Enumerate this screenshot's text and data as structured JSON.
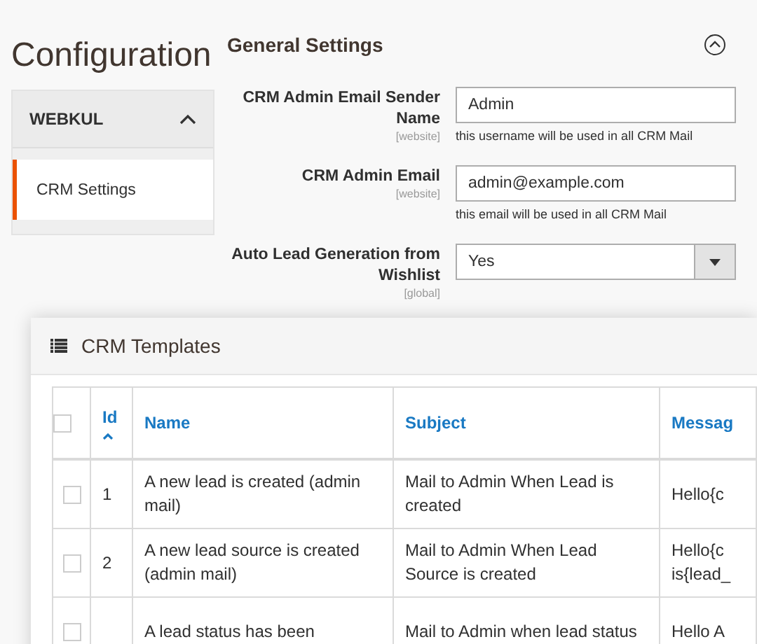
{
  "page_title": "Configuration",
  "sidebar": {
    "group": {
      "label": "WEBKUL",
      "expanded": true
    },
    "items": [
      {
        "label": "CRM Settings",
        "selected": true
      }
    ]
  },
  "section": {
    "title": "General Settings",
    "expanded": true,
    "fields": [
      {
        "kind": "text",
        "label": "CRM Admin Email Sender Name",
        "scope": "[website]",
        "value": "Admin",
        "note": "this username will be used in all CRM Mail"
      },
      {
        "kind": "text",
        "label": "CRM Admin Email",
        "scope": "[website]",
        "value": "admin@example.com",
        "note": "this email will be used in all CRM Mail"
      },
      {
        "kind": "select",
        "label": "Auto Lead Generation from Wishlist",
        "scope": "[global]",
        "value": "Yes"
      }
    ]
  },
  "modal": {
    "title": "CRM Templates",
    "table": {
      "select_all_checked": false,
      "columns": [
        {
          "label": "Id",
          "sorted": true
        },
        {
          "label": "Name",
          "sorted": false
        },
        {
          "label": "Subject",
          "sorted": false
        },
        {
          "label": "Messag",
          "sorted": false
        }
      ],
      "rows": [
        {
          "checked": false,
          "cells": [
            "1",
            "A new lead is created (admin mail)",
            "Mail to Admin When Lead is created",
            "Hello{c"
          ]
        },
        {
          "checked": false,
          "cells": [
            "2",
            "A new lead source is created (admin mail)",
            "Mail to Admin When Lead Source is created",
            "Hello{c\nis{lead_"
          ]
        },
        {
          "checked": false,
          "cells": [
            "",
            "A lead status has been",
            "Mail to Admin when lead status",
            "Hello A"
          ]
        }
      ]
    }
  }
}
